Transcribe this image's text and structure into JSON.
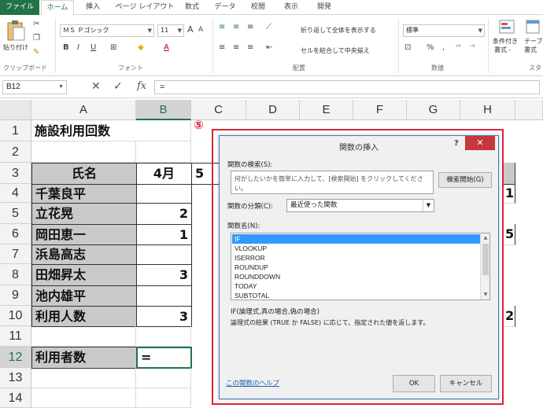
{
  "ribbon_tabs": [
    "ファイル",
    "ホーム",
    "挿入",
    "ページ レイアウト",
    "数式",
    "データ",
    "校閲",
    "表示",
    "開発"
  ],
  "ribbon": {
    "paste_label": "貼り付け",
    "clipboard_group": "クリップボード",
    "font_name": "ＭＳ Ｐゴシック",
    "font_size": "11",
    "font_group": "フォント",
    "bold": "B",
    "italic": "I",
    "underline": "U",
    "font_grow": "A",
    "font_shrink": "A",
    "font_color_glyph": "A",
    "wrap_text": "折り返して全体を表示する",
    "merge_center": "セルを結合して中央揃え",
    "alignment_group": "配置",
    "number_format": "標準",
    "percent": "%",
    "comma": ",",
    "number_group": "数値",
    "conditional_format": "条件付き",
    "conditional_format_2": "書式 -",
    "table_format": "テーブ",
    "table_format_2": "書式",
    "styles_group_partial": "スタ"
  },
  "formula_bar": {
    "name_box": "B12",
    "cancel": "✕",
    "enter": "✓",
    "fx": "fx",
    "formula": "="
  },
  "sheet": {
    "columns": [
      "A",
      "B",
      "C",
      "D",
      "E",
      "F",
      "G",
      "H"
    ],
    "rows": [
      "1",
      "2",
      "3",
      "4",
      "5",
      "6",
      "7",
      "8",
      "9",
      "10",
      "11",
      "12",
      "13",
      "14"
    ],
    "title": "施設利用回数",
    "header_name": "氏名",
    "header_april": "4月",
    "header_may_partial": "5",
    "names": [
      "千葉良平",
      "立花晃",
      "岡田恵一",
      "浜島高志",
      "田畑昇太",
      "池内雄平"
    ],
    "april_values": [
      "",
      "2",
      "1",
      "",
      "3",
      ""
    ],
    "usage_label": "利用人数",
    "usage_april": "3",
    "users_label": "利用者数",
    "active_cell_value": "=",
    "h_col_partial": [
      "1",
      "5",
      "2"
    ]
  },
  "annotation": {
    "step_number": "⑤"
  },
  "dialog": {
    "title": "関数の挿入",
    "help_glyph": "?",
    "close_glyph": "✕",
    "search_label": "関数の検索(S):",
    "search_placeholder": "何がしたいかを簡単に入力して、[検索開始] をクリックしてください。",
    "search_button": "検索開始(G)",
    "category_label": "関数の分類(C):",
    "category_value": "最近使った関数",
    "function_name_label": "関数名(N):",
    "functions": [
      "IF",
      "VLOOKUP",
      "ISERROR",
      "ROUNDUP",
      "ROUNDDOWN",
      "TODAY",
      "SUBTOTAL"
    ],
    "syntax": "IF(論理式,真の場合,偽の場合)",
    "description": "論理式の結果 (TRUE か FALSE) に応じて、指定された値を返します。",
    "help_link": "この関数のヘルプ",
    "ok_button": "OK",
    "cancel_button": "キャンセル"
  },
  "colors": {
    "excel_green": "#217346",
    "annotation_red": "#d9243a",
    "selection_blue": "#3399ff",
    "close_red": "#c7383c"
  }
}
